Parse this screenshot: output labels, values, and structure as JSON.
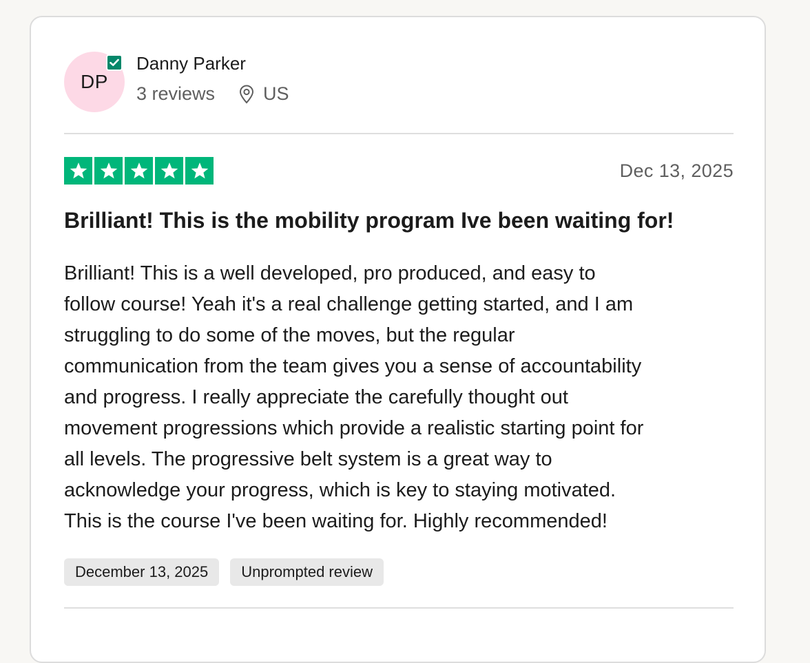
{
  "reviewer": {
    "initials": "DP",
    "name": "Danny Parker",
    "reviews_count": "3 reviews",
    "country": "US",
    "verified": true,
    "avatar_color": "#fdd9e6",
    "verified_color": "#04876a"
  },
  "review": {
    "rating": 5,
    "rating_max": 5,
    "star_color": "#00b67a",
    "date": "Dec 13, 2025",
    "title": "Brilliant! This is the mobility program Ive been waiting for!",
    "body_lines": [
      "Brilliant! This is a well developed, pro produced, and easy to",
      "follow course! Yeah it's a real challenge getting started, and I am",
      "struggling to do some of the moves, but the regular",
      "communication from the team gives you a sense of accountability",
      "and progress. I really appreciate the carefully thought out",
      "movement progressions which provide a realistic starting point for",
      "all levels. The progressive belt system is a great way to",
      "acknowledge your progress, which is key to staying motivated.",
      "This is the course I've been waiting for. Highly recommended!"
    ],
    "tags": [
      "December 13, 2025",
      "Unprompted review"
    ]
  },
  "icons": {
    "verified": "verified-check-icon",
    "location": "location-pin-icon",
    "star": "star-icon"
  }
}
